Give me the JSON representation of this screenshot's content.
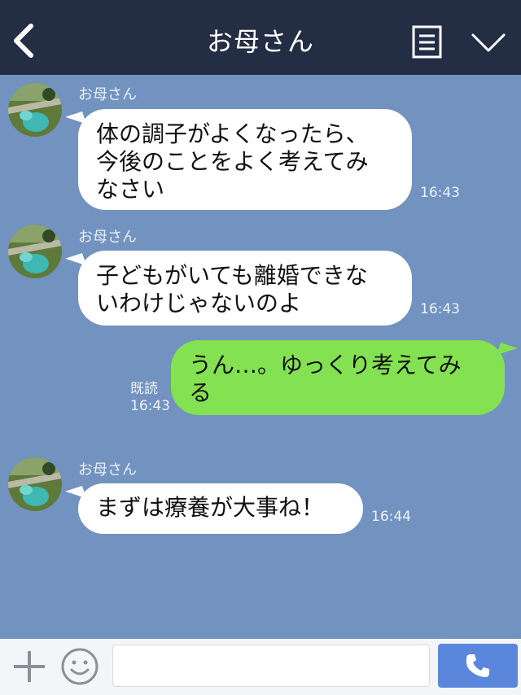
{
  "header": {
    "title": "お母さん"
  },
  "messages": [
    {
      "sender": "お母さん",
      "text": "体の調子がよくなったら、\n今後のことをよく考えてみ\nなさい",
      "time": "16:43"
    },
    {
      "sender": "お母さん",
      "text": "子どもがいても離婚できな\nいわけじゃないのよ",
      "time": "16:43"
    },
    {
      "text": "うん…。ゆっくり考えてみ\nる",
      "read": "既読",
      "time": "16:43"
    },
    {
      "sender": "お母さん",
      "text": "まずは療養が大事ね！",
      "time": "16:44"
    }
  ],
  "composer": {
    "placeholder": ""
  },
  "colors": {
    "header": "#232e45",
    "background": "#7292c0",
    "outgoing": "#84e152",
    "send": "#5a86dc"
  }
}
